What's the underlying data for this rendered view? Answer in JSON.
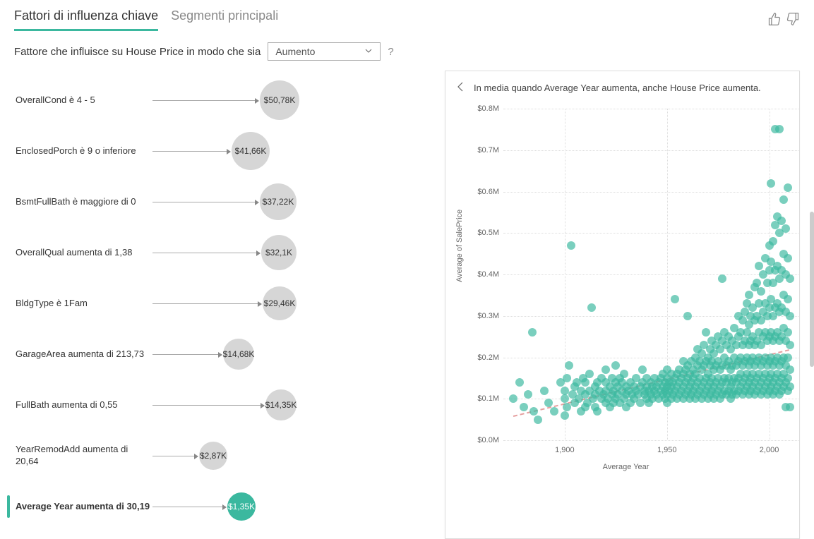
{
  "tabs": {
    "key_influencers": "Fattori di influenza chiave",
    "top_segments": "Segmenti principali"
  },
  "question": {
    "prefix": "Fattore che influisce su House Price in modo che sia",
    "dropdown_value": "Aumento",
    "help": "?"
  },
  "influencers": [
    {
      "label": "OverallCond è 4 - 5",
      "value": "$50,78K",
      "size": 56,
      "arrow": 150
    },
    {
      "label": "EnclosedPorch è 9 o inferiore",
      "value": "$41,66K",
      "size": 54,
      "arrow": 110
    },
    {
      "label": "BsmtFullBath è maggiore di 0",
      "value": "$37,22K",
      "size": 52,
      "arrow": 150
    },
    {
      "label": "OverallQual aumenta di 1,38",
      "value": "$32,1K",
      "size": 50,
      "arrow": 152
    },
    {
      "label": "BldgType è 1Fam",
      "value": "$29,46K",
      "size": 48,
      "arrow": 154
    },
    {
      "label": "GarageArea aumenta di 213,73",
      "value": "$14,68K",
      "size": 44,
      "arrow": 98
    },
    {
      "label": "FullBath aumenta di 0,55",
      "value": "$14,35K",
      "size": 44,
      "arrow": 158
    },
    {
      "label": "YearRemodAdd aumenta di 20,64",
      "value": "$2,87K",
      "size": 40,
      "arrow": 64
    },
    {
      "label": "Average Year aumenta di 30,19",
      "value": "$1,35K",
      "size": 40,
      "arrow": 104,
      "selected": true
    }
  ],
  "detail": {
    "headline": "In media quando Average Year aumenta, anche House Price aumenta.",
    "y_label": "Average of SalePrice",
    "x_label": "Average Year"
  },
  "chart_data": {
    "type": "scatter",
    "title": "In media quando Average Year aumenta, anche House Price aumenta.",
    "xlabel": "Average Year",
    "ylabel": "Average of SalePrice",
    "xlim": [
      1870,
      2015
    ],
    "ylim": [
      0,
      0.8
    ],
    "y_unit": "M",
    "y_ticks": [
      {
        "v": 0.0,
        "label": "$0.0M"
      },
      {
        "v": 0.1,
        "label": "$0.1M"
      },
      {
        "v": 0.2,
        "label": "$0.2M"
      },
      {
        "v": 0.3,
        "label": "$0.3M"
      },
      {
        "v": 0.4,
        "label": "$0.4M"
      },
      {
        "v": 0.5,
        "label": "$0.5M"
      },
      {
        "v": 0.6,
        "label": "$0.6M"
      },
      {
        "v": 0.7,
        "label": "$0.7M"
      },
      {
        "v": 0.8,
        "label": "$0.8M"
      }
    ],
    "x_ticks": [
      {
        "v": 1900,
        "label": "1,900"
      },
      {
        "v": 1950,
        "label": "1,950"
      },
      {
        "v": 2000,
        "label": "2,000"
      }
    ],
    "trend": {
      "x1": 1875,
      "y1": 0.06,
      "x2": 2010,
      "y2": 0.22
    },
    "points": [
      [
        1875,
        0.1
      ],
      [
        1878,
        0.14
      ],
      [
        1880,
        0.08
      ],
      [
        1882,
        0.11
      ],
      [
        1884,
        0.26
      ],
      [
        1885,
        0.07
      ],
      [
        1887,
        0.05
      ],
      [
        1890,
        0.12
      ],
      [
        1892,
        0.09
      ],
      [
        1895,
        0.07
      ],
      [
        1898,
        0.14
      ],
      [
        1900,
        0.06
      ],
      [
        1900,
        0.1
      ],
      [
        1900,
        0.12
      ],
      [
        1901,
        0.08
      ],
      [
        1901,
        0.15
      ],
      [
        1902,
        0.18
      ],
      [
        1903,
        0.47
      ],
      [
        1904,
        0.11
      ],
      [
        1905,
        0.09
      ],
      [
        1905,
        0.13
      ],
      [
        1906,
        0.14
      ],
      [
        1907,
        0.1
      ],
      [
        1908,
        0.07
      ],
      [
        1908,
        0.12
      ],
      [
        1909,
        0.15
      ],
      [
        1910,
        0.08
      ],
      [
        1910,
        0.11
      ],
      [
        1910,
        0.14
      ],
      [
        1911,
        0.09
      ],
      [
        1912,
        0.12
      ],
      [
        1912,
        0.16
      ],
      [
        1913,
        0.32
      ],
      [
        1914,
        0.1
      ],
      [
        1915,
        0.08
      ],
      [
        1915,
        0.11
      ],
      [
        1915,
        0.13
      ],
      [
        1916,
        0.07
      ],
      [
        1916,
        0.14
      ],
      [
        1917,
        0.12
      ],
      [
        1918,
        0.1
      ],
      [
        1918,
        0.15
      ],
      [
        1919,
        0.11
      ],
      [
        1920,
        0.09
      ],
      [
        1920,
        0.12
      ],
      [
        1920,
        0.14
      ],
      [
        1920,
        0.17
      ],
      [
        1921,
        0.1
      ],
      [
        1922,
        0.08
      ],
      [
        1922,
        0.13
      ],
      [
        1923,
        0.11
      ],
      [
        1923,
        0.15
      ],
      [
        1924,
        0.09
      ],
      [
        1924,
        0.12
      ],
      [
        1925,
        0.1
      ],
      [
        1925,
        0.14
      ],
      [
        1925,
        0.18
      ],
      [
        1926,
        0.11
      ],
      [
        1926,
        0.13
      ],
      [
        1927,
        0.09
      ],
      [
        1927,
        0.15
      ],
      [
        1928,
        0.12
      ],
      [
        1928,
        0.14
      ],
      [
        1929,
        0.1
      ],
      [
        1929,
        0.16
      ],
      [
        1930,
        0.08
      ],
      [
        1930,
        0.11
      ],
      [
        1930,
        0.13
      ],
      [
        1931,
        0.12
      ],
      [
        1932,
        0.09
      ],
      [
        1932,
        0.14
      ],
      [
        1933,
        0.11
      ],
      [
        1934,
        0.1
      ],
      [
        1934,
        0.13
      ],
      [
        1935,
        0.12
      ],
      [
        1935,
        0.15
      ],
      [
        1936,
        0.11
      ],
      [
        1937,
        0.09
      ],
      [
        1937,
        0.13
      ],
      [
        1938,
        0.14
      ],
      [
        1938,
        0.17
      ],
      [
        1939,
        0.11
      ],
      [
        1939,
        0.12
      ],
      [
        1940,
        0.1
      ],
      [
        1940,
        0.13
      ],
      [
        1940,
        0.15
      ],
      [
        1941,
        0.09
      ],
      [
        1941,
        0.12
      ],
      [
        1942,
        0.11
      ],
      [
        1942,
        0.14
      ],
      [
        1943,
        0.1
      ],
      [
        1943,
        0.13
      ],
      [
        1944,
        0.12
      ],
      [
        1944,
        0.15
      ],
      [
        1945,
        0.11
      ],
      [
        1945,
        0.13
      ],
      [
        1946,
        0.1
      ],
      [
        1946,
        0.14
      ],
      [
        1947,
        0.12
      ],
      [
        1947,
        0.15
      ],
      [
        1948,
        0.11
      ],
      [
        1948,
        0.13
      ],
      [
        1948,
        0.16
      ],
      [
        1949,
        0.1
      ],
      [
        1949,
        0.12
      ],
      [
        1949,
        0.14
      ],
      [
        1950,
        0.09
      ],
      [
        1950,
        0.11
      ],
      [
        1950,
        0.13
      ],
      [
        1950,
        0.15
      ],
      [
        1950,
        0.17
      ],
      [
        1951,
        0.12
      ],
      [
        1951,
        0.14
      ],
      [
        1952,
        0.1
      ],
      [
        1952,
        0.13
      ],
      [
        1952,
        0.16
      ],
      [
        1953,
        0.11
      ],
      [
        1953,
        0.14
      ],
      [
        1954,
        0.12
      ],
      [
        1954,
        0.15
      ],
      [
        1954,
        0.34
      ],
      [
        1955,
        0.1
      ],
      [
        1955,
        0.13
      ],
      [
        1955,
        0.16
      ],
      [
        1956,
        0.11
      ],
      [
        1956,
        0.14
      ],
      [
        1956,
        0.17
      ],
      [
        1957,
        0.12
      ],
      [
        1957,
        0.15
      ],
      [
        1958,
        0.1
      ],
      [
        1958,
        0.13
      ],
      [
        1958,
        0.16
      ],
      [
        1958,
        0.19
      ],
      [
        1959,
        0.11
      ],
      [
        1959,
        0.14
      ],
      [
        1959,
        0.17
      ],
      [
        1960,
        0.12
      ],
      [
        1960,
        0.15
      ],
      [
        1960,
        0.18
      ],
      [
        1960,
        0.3
      ],
      [
        1961,
        0.1
      ],
      [
        1961,
        0.13
      ],
      [
        1961,
        0.16
      ],
      [
        1962,
        0.11
      ],
      [
        1962,
        0.14
      ],
      [
        1962,
        0.19
      ],
      [
        1963,
        0.12
      ],
      [
        1963,
        0.15
      ],
      [
        1963,
        0.17
      ],
      [
        1964,
        0.1
      ],
      [
        1964,
        0.13
      ],
      [
        1964,
        0.16
      ],
      [
        1964,
        0.2
      ],
      [
        1965,
        0.11
      ],
      [
        1965,
        0.14
      ],
      [
        1965,
        0.18
      ],
      [
        1965,
        0.22
      ],
      [
        1966,
        0.12
      ],
      [
        1966,
        0.15
      ],
      [
        1966,
        0.19
      ],
      [
        1967,
        0.1
      ],
      [
        1967,
        0.13
      ],
      [
        1967,
        0.17
      ],
      [
        1967,
        0.21
      ],
      [
        1968,
        0.11
      ],
      [
        1968,
        0.14
      ],
      [
        1968,
        0.18
      ],
      [
        1968,
        0.23
      ],
      [
        1969,
        0.12
      ],
      [
        1969,
        0.15
      ],
      [
        1969,
        0.19
      ],
      [
        1969,
        0.26
      ],
      [
        1970,
        0.1
      ],
      [
        1970,
        0.13
      ],
      [
        1970,
        0.16
      ],
      [
        1970,
        0.2
      ],
      [
        1971,
        0.11
      ],
      [
        1971,
        0.14
      ],
      [
        1971,
        0.18
      ],
      [
        1971,
        0.22
      ],
      [
        1972,
        0.12
      ],
      [
        1972,
        0.15
      ],
      [
        1972,
        0.19
      ],
      [
        1972,
        0.24
      ],
      [
        1973,
        0.1
      ],
      [
        1973,
        0.13
      ],
      [
        1973,
        0.17
      ],
      [
        1973,
        0.21
      ],
      [
        1974,
        0.11
      ],
      [
        1974,
        0.14
      ],
      [
        1974,
        0.18
      ],
      [
        1974,
        0.23
      ],
      [
        1975,
        0.12
      ],
      [
        1975,
        0.15
      ],
      [
        1975,
        0.19
      ],
      [
        1975,
        0.25
      ],
      [
        1976,
        0.1
      ],
      [
        1976,
        0.13
      ],
      [
        1976,
        0.17
      ],
      [
        1976,
        0.22
      ],
      [
        1977,
        0.11
      ],
      [
        1977,
        0.14
      ],
      [
        1977,
        0.18
      ],
      [
        1977,
        0.24
      ],
      [
        1977,
        0.39
      ],
      [
        1978,
        0.12
      ],
      [
        1978,
        0.15
      ],
      [
        1978,
        0.2
      ],
      [
        1978,
        0.26
      ],
      [
        1979,
        0.11
      ],
      [
        1979,
        0.14
      ],
      [
        1979,
        0.18
      ],
      [
        1979,
        0.23
      ],
      [
        1980,
        0.12
      ],
      [
        1980,
        0.15
      ],
      [
        1980,
        0.19
      ],
      [
        1980,
        0.25
      ],
      [
        1981,
        0.1
      ],
      [
        1981,
        0.13
      ],
      [
        1981,
        0.17
      ],
      [
        1981,
        0.22
      ],
      [
        1982,
        0.11
      ],
      [
        1982,
        0.14
      ],
      [
        1982,
        0.18
      ],
      [
        1982,
        0.24
      ],
      [
        1983,
        0.12
      ],
      [
        1983,
        0.15
      ],
      [
        1983,
        0.2
      ],
      [
        1983,
        0.27
      ],
      [
        1984,
        0.11
      ],
      [
        1984,
        0.14
      ],
      [
        1984,
        0.18
      ],
      [
        1984,
        0.23
      ],
      [
        1985,
        0.12
      ],
      [
        1985,
        0.15
      ],
      [
        1985,
        0.19
      ],
      [
        1985,
        0.25
      ],
      [
        1985,
        0.3
      ],
      [
        1986,
        0.13
      ],
      [
        1986,
        0.16
      ],
      [
        1986,
        0.2
      ],
      [
        1986,
        0.26
      ],
      [
        1987,
        0.11
      ],
      [
        1987,
        0.14
      ],
      [
        1987,
        0.18
      ],
      [
        1987,
        0.23
      ],
      [
        1987,
        0.29
      ],
      [
        1988,
        0.12
      ],
      [
        1988,
        0.15
      ],
      [
        1988,
        0.19
      ],
      [
        1988,
        0.24
      ],
      [
        1988,
        0.31
      ],
      [
        1989,
        0.13
      ],
      [
        1989,
        0.16
      ],
      [
        1989,
        0.2
      ],
      [
        1989,
        0.26
      ],
      [
        1989,
        0.33
      ],
      [
        1990,
        0.11
      ],
      [
        1990,
        0.14
      ],
      [
        1990,
        0.18
      ],
      [
        1990,
        0.23
      ],
      [
        1990,
        0.28
      ],
      [
        1990,
        0.35
      ],
      [
        1991,
        0.12
      ],
      [
        1991,
        0.15
      ],
      [
        1991,
        0.19
      ],
      [
        1991,
        0.24
      ],
      [
        1991,
        0.3
      ],
      [
        1992,
        0.13
      ],
      [
        1992,
        0.16
      ],
      [
        1992,
        0.2
      ],
      [
        1992,
        0.25
      ],
      [
        1992,
        0.32
      ],
      [
        1993,
        0.11
      ],
      [
        1993,
        0.14
      ],
      [
        1993,
        0.18
      ],
      [
        1993,
        0.23
      ],
      [
        1993,
        0.29
      ],
      [
        1993,
        0.37
      ],
      [
        1994,
        0.12
      ],
      [
        1994,
        0.15
      ],
      [
        1994,
        0.19
      ],
      [
        1994,
        0.24
      ],
      [
        1994,
        0.3
      ],
      [
        1994,
        0.38
      ],
      [
        1995,
        0.13
      ],
      [
        1995,
        0.16
      ],
      [
        1995,
        0.2
      ],
      [
        1995,
        0.26
      ],
      [
        1995,
        0.33
      ],
      [
        1995,
        0.42
      ],
      [
        1996,
        0.11
      ],
      [
        1996,
        0.14
      ],
      [
        1996,
        0.18
      ],
      [
        1996,
        0.23
      ],
      [
        1996,
        0.29
      ],
      [
        1996,
        0.36
      ],
      [
        1997,
        0.12
      ],
      [
        1997,
        0.15
      ],
      [
        1997,
        0.19
      ],
      [
        1997,
        0.25
      ],
      [
        1997,
        0.31
      ],
      [
        1997,
        0.4
      ],
      [
        1998,
        0.13
      ],
      [
        1998,
        0.16
      ],
      [
        1998,
        0.2
      ],
      [
        1998,
        0.26
      ],
      [
        1998,
        0.33
      ],
      [
        1998,
        0.44
      ],
      [
        1999,
        0.11
      ],
      [
        1999,
        0.14
      ],
      [
        1999,
        0.18
      ],
      [
        1999,
        0.24
      ],
      [
        1999,
        0.3
      ],
      [
        1999,
        0.38
      ],
      [
        2000,
        0.12
      ],
      [
        2000,
        0.15
      ],
      [
        2000,
        0.19
      ],
      [
        2000,
        0.25
      ],
      [
        2000,
        0.32
      ],
      [
        2000,
        0.41
      ],
      [
        2000,
        0.47
      ],
      [
        2001,
        0.13
      ],
      [
        2001,
        0.16
      ],
      [
        2001,
        0.2
      ],
      [
        2001,
        0.26
      ],
      [
        2001,
        0.34
      ],
      [
        2001,
        0.43
      ],
      [
        2001,
        0.62
      ],
      [
        2002,
        0.11
      ],
      [
        2002,
        0.14
      ],
      [
        2002,
        0.18
      ],
      [
        2002,
        0.24
      ],
      [
        2002,
        0.3
      ],
      [
        2002,
        0.38
      ],
      [
        2002,
        0.48
      ],
      [
        2003,
        0.12
      ],
      [
        2003,
        0.15
      ],
      [
        2003,
        0.19
      ],
      [
        2003,
        0.25
      ],
      [
        2003,
        0.32
      ],
      [
        2003,
        0.41
      ],
      [
        2003,
        0.52
      ],
      [
        2003,
        0.75
      ],
      [
        2004,
        0.13
      ],
      [
        2004,
        0.16
      ],
      [
        2004,
        0.2
      ],
      [
        2004,
        0.26
      ],
      [
        2004,
        0.33
      ],
      [
        2004,
        0.42
      ],
      [
        2004,
        0.54
      ],
      [
        2005,
        0.11
      ],
      [
        2005,
        0.14
      ],
      [
        2005,
        0.18
      ],
      [
        2005,
        0.24
      ],
      [
        2005,
        0.31
      ],
      [
        2005,
        0.39
      ],
      [
        2005,
        0.5
      ],
      [
        2005,
        0.75
      ],
      [
        2006,
        0.12
      ],
      [
        2006,
        0.15
      ],
      [
        2006,
        0.19
      ],
      [
        2006,
        0.25
      ],
      [
        2006,
        0.32
      ],
      [
        2006,
        0.41
      ],
      [
        2006,
        0.53
      ],
      [
        2007,
        0.13
      ],
      [
        2007,
        0.16
      ],
      [
        2007,
        0.2
      ],
      [
        2007,
        0.27
      ],
      [
        2007,
        0.35
      ],
      [
        2007,
        0.45
      ],
      [
        2007,
        0.58
      ],
      [
        2008,
        0.08
      ],
      [
        2008,
        0.14
      ],
      [
        2008,
        0.18
      ],
      [
        2008,
        0.24
      ],
      [
        2008,
        0.31
      ],
      [
        2008,
        0.4
      ],
      [
        2008,
        0.51
      ],
      [
        2009,
        0.12
      ],
      [
        2009,
        0.15
      ],
      [
        2009,
        0.2
      ],
      [
        2009,
        0.26
      ],
      [
        2009,
        0.34
      ],
      [
        2009,
        0.44
      ],
      [
        2009,
        0.61
      ],
      [
        2010,
        0.08
      ],
      [
        2010,
        0.13
      ],
      [
        2010,
        0.17
      ],
      [
        2010,
        0.23
      ],
      [
        2010,
        0.3
      ],
      [
        2010,
        0.39
      ]
    ]
  }
}
